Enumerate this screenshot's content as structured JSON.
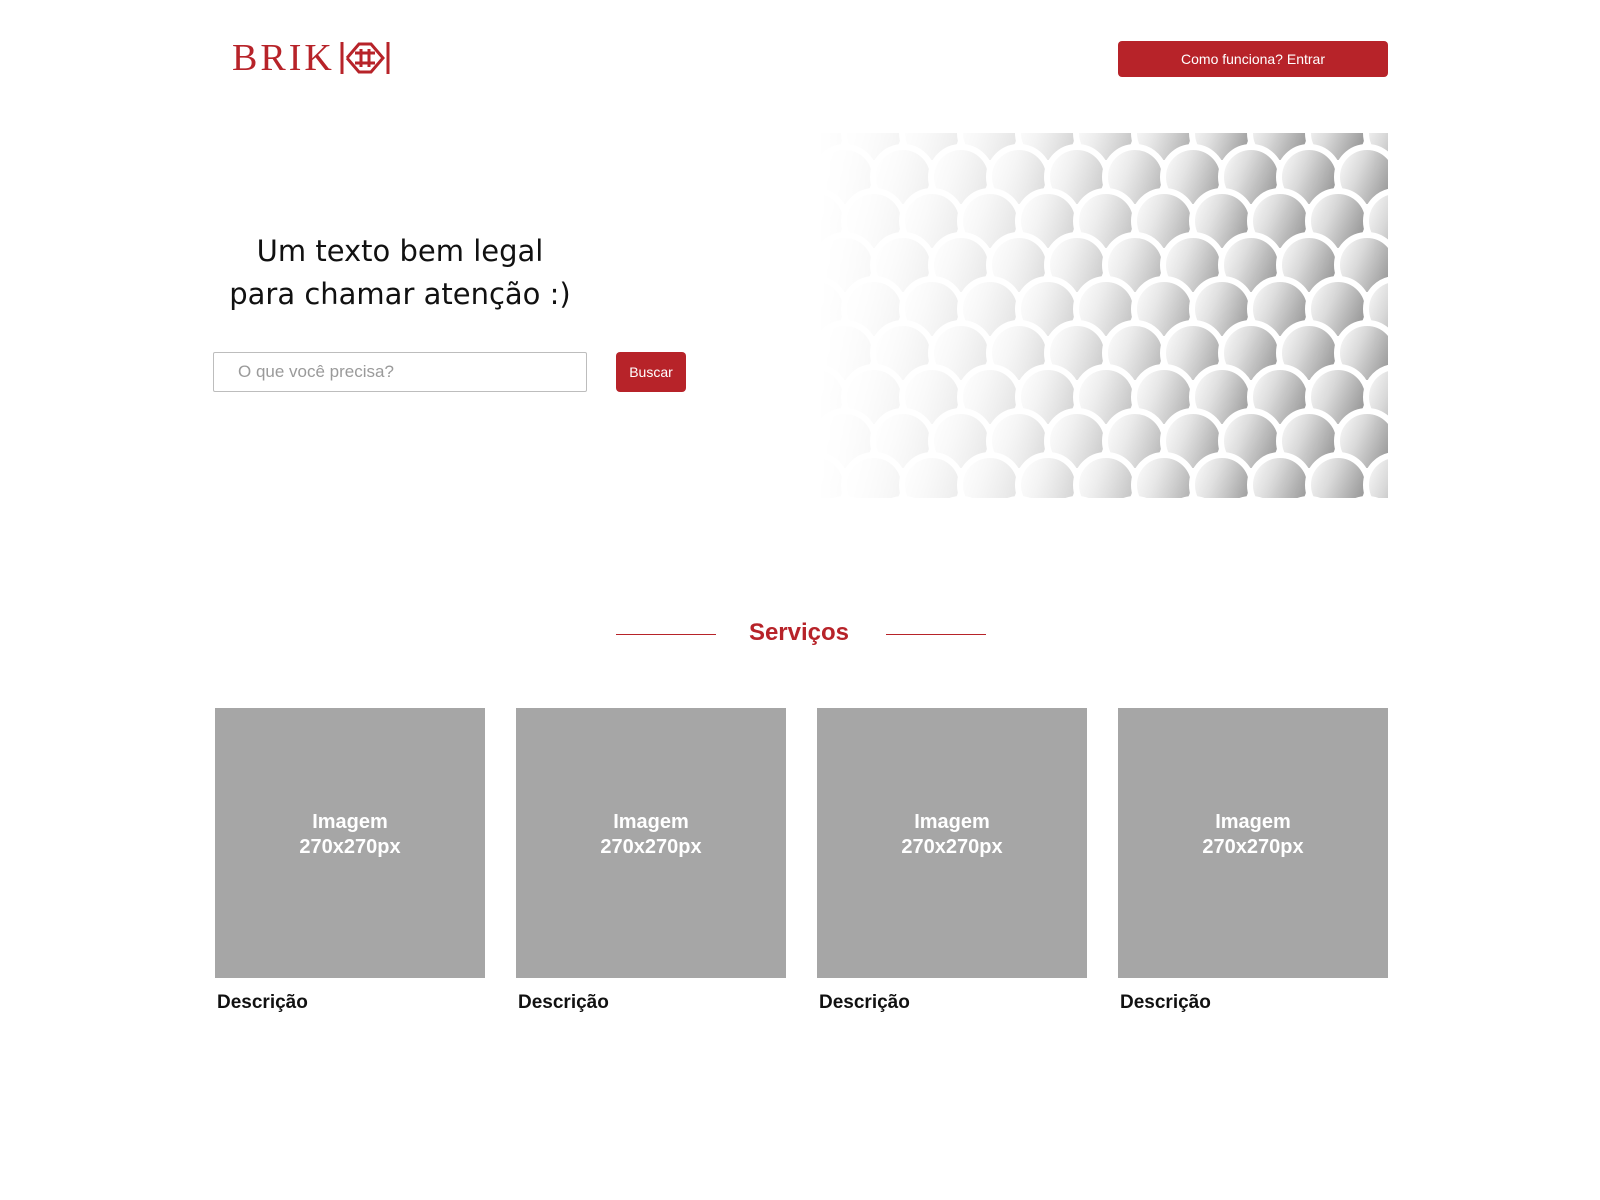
{
  "header": {
    "logo_text": "BRIK",
    "cta_label": "Como funciona? Entrar"
  },
  "hero": {
    "heading_line1": "Um texto bem legal",
    "heading_line2": "para chamar atenção :)",
    "search": {
      "placeholder": "O que você precisa?",
      "value": "",
      "button_label": "Buscar"
    },
    "image_icon": "scale-pattern-image"
  },
  "services": {
    "title": "Serviços",
    "cards": [
      {
        "image_line1": "Imagem",
        "image_line2": "270x270px",
        "description": "Descrição"
      },
      {
        "image_line1": "Imagem",
        "image_line2": "270x270px",
        "description": "Descrição"
      },
      {
        "image_line1": "Imagem",
        "image_line2": "270x270px",
        "description": "Descrição"
      },
      {
        "image_line1": "Imagem",
        "image_line2": "270x270px",
        "description": "Descrição"
      }
    ]
  },
  "colors": {
    "brand": "#b72329",
    "placeholder_gray": "#a6a6a6",
    "text": "#111111"
  }
}
